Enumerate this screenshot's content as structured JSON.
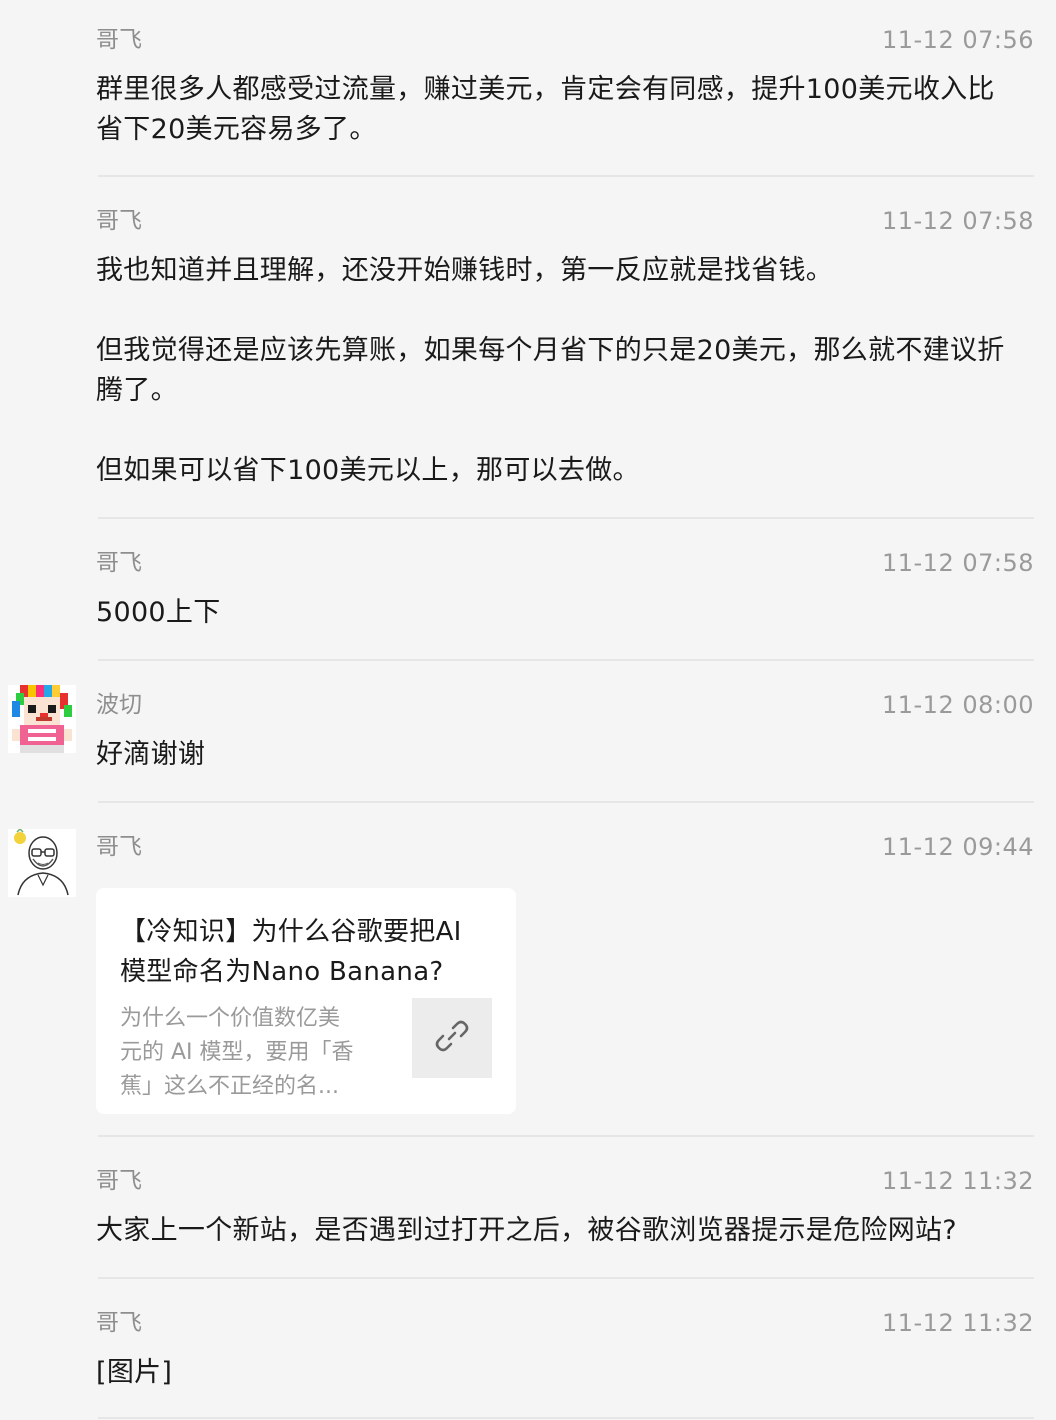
{
  "messages": [
    {
      "sender": "哥飞",
      "time": "11-12 07:56",
      "text": "群里很多人都感受过流量，赚过美元，肯定会有同感，提升100美元收入比\n省下20美元容易多了。"
    },
    {
      "sender": "哥飞",
      "time": "11-12 07:58",
      "text": "我也知道并且理解，还没开始赚钱时，第一反应就是找省钱。\n\n但我觉得还是应该先算账，如果每个月省下的只是20美元，那么就不建议折\n腾了。\n\n但如果可以省下100美元以上，那可以去做。"
    },
    {
      "sender": "哥飞",
      "time": "11-12 07:58",
      "text": "5000上下"
    },
    {
      "sender": "波切",
      "time": "11-12 08:00",
      "text": "好滴谢谢"
    },
    {
      "sender": "哥飞",
      "time": "11-12 09:44",
      "link_card": {
        "title": "【冷知识】为什么谷歌要把AI\n模型命名为Nano Banana?",
        "description": "为什么一个价值数亿美\n元的 AI 模型，要用「香\n蕉」这么不正经的名...",
        "thumb_icon": "link-icon"
      }
    },
    {
      "sender": "哥飞",
      "time": "11-12 11:32",
      "text": "大家上一个新站，是否遇到过打开之后，被谷歌浏览器提示是危险网站?"
    },
    {
      "sender": "哥飞",
      "time": "11-12 11:32",
      "text": "[图片]"
    }
  ],
  "avatars": {
    "bochie": "pixel-clown-avatar",
    "gefei": "bald-glasses-man-avatar"
  }
}
